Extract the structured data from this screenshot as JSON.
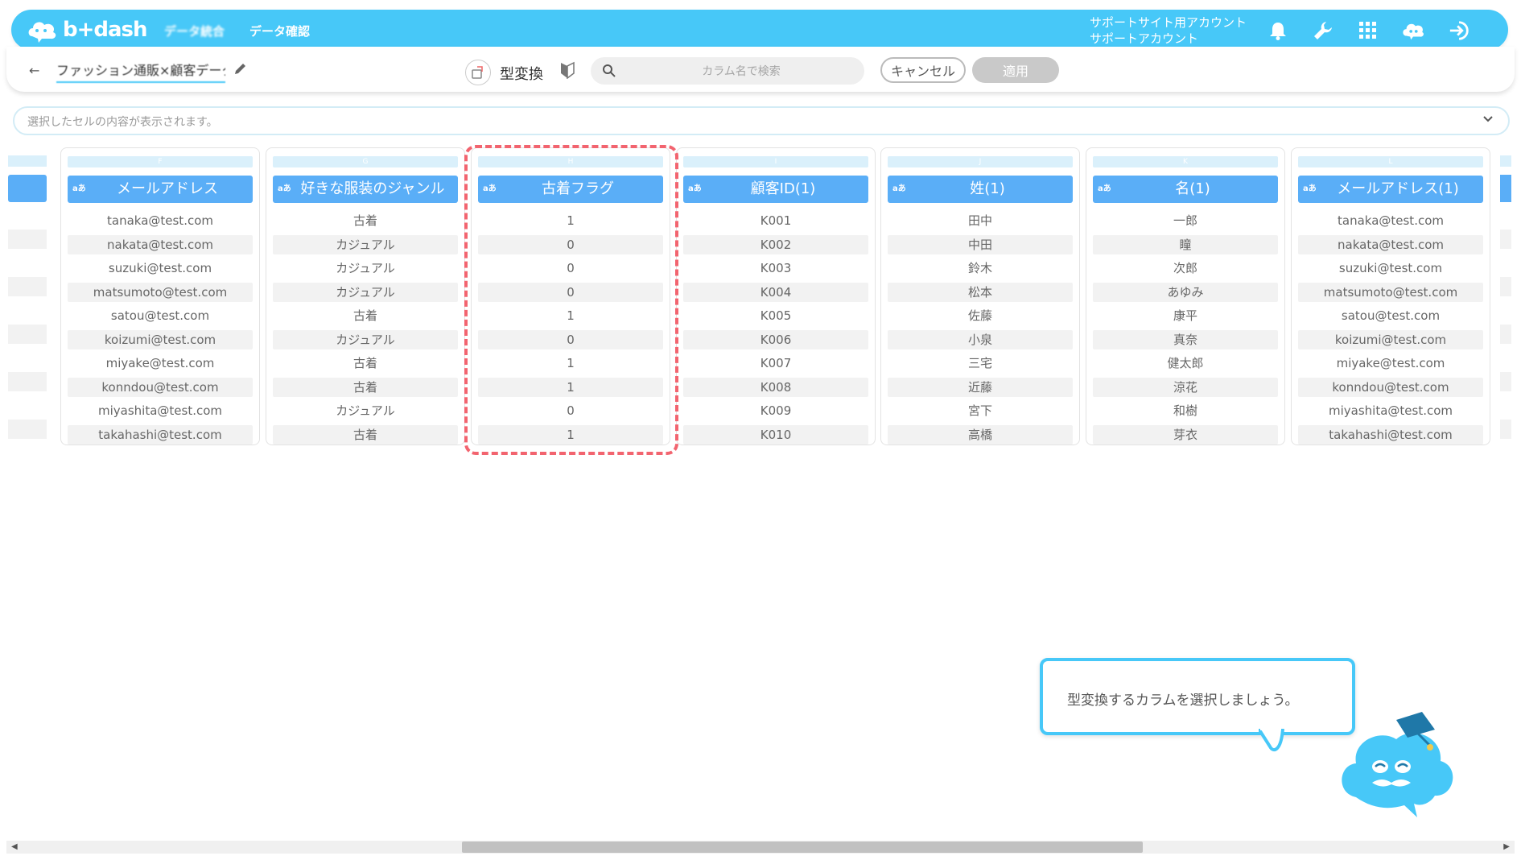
{
  "header": {
    "logo_text": "b+dash",
    "tabs": [
      "データ統合",
      "データ確認"
    ],
    "account_line1": "サポートサイト用アカウント",
    "account_line2": "サポートアカウント"
  },
  "toolbar": {
    "file_name": "ファッション通販×顧客データ",
    "type_convert_label": "型変換",
    "search_placeholder": "カラム名で検索",
    "cancel_label": "キャンセル",
    "apply_label": "適用"
  },
  "cellbar": {
    "placeholder": "選択したセルの内容が表示されます。"
  },
  "columns": [
    {
      "letter": "F",
      "type": "aあ",
      "name": "メールアドレス",
      "cells": [
        "tanaka@test.com",
        "nakata@test.com",
        "suzuki@test.com",
        "matsumoto@test.com",
        "satou@test.com",
        "koizumi@test.com",
        "miyake@test.com",
        "konndou@test.com",
        "miyashita@test.com",
        "takahashi@test.com"
      ]
    },
    {
      "letter": "G",
      "type": "aあ",
      "name": "好きな服装のジャンル",
      "cells": [
        "古着",
        "カジュアル",
        "カジュアル",
        "カジュアル",
        "古着",
        "カジュアル",
        "古着",
        "古着",
        "カジュアル",
        "古着"
      ]
    },
    {
      "letter": "H",
      "type": "aあ",
      "name": "古着フラグ",
      "cells": [
        "1",
        "0",
        "0",
        "0",
        "1",
        "0",
        "1",
        "1",
        "0",
        "1"
      ]
    },
    {
      "letter": "I",
      "type": "aあ",
      "name": "顧客ID(1)",
      "cells": [
        "K001",
        "K002",
        "K003",
        "K004",
        "K005",
        "K006",
        "K007",
        "K008",
        "K009",
        "K010"
      ]
    },
    {
      "letter": "J",
      "type": "aあ",
      "name": "姓(1)",
      "cells": [
        "田中",
        "中田",
        "鈴木",
        "松本",
        "佐藤",
        "小泉",
        "三宅",
        "近藤",
        "宮下",
        "高橋"
      ]
    },
    {
      "letter": "K",
      "type": "aあ",
      "name": "名(1)",
      "cells": [
        "一郎",
        "瞳",
        "次郎",
        "あゆみ",
        "康平",
        "真奈",
        "健太郎",
        "涼花",
        "和樹",
        "芽衣"
      ]
    },
    {
      "letter": "L",
      "type": "aあ",
      "name": "メールアドレス(1)",
      "cells": [
        "tanaka@test.com",
        "nakata@test.com",
        "suzuki@test.com",
        "matsumoto@test.com",
        "satou@test.com",
        "koizumi@test.com",
        "miyake@test.com",
        "konndou@test.com",
        "miyashita@test.com",
        "takahashi@test.com"
      ]
    }
  ],
  "tooltip": {
    "text": "型変換するカラムを選択しましょう。"
  },
  "colors": {
    "header_bg": "#47c8f8",
    "column_header": "#5aaef7",
    "highlight": "#f2646f"
  }
}
